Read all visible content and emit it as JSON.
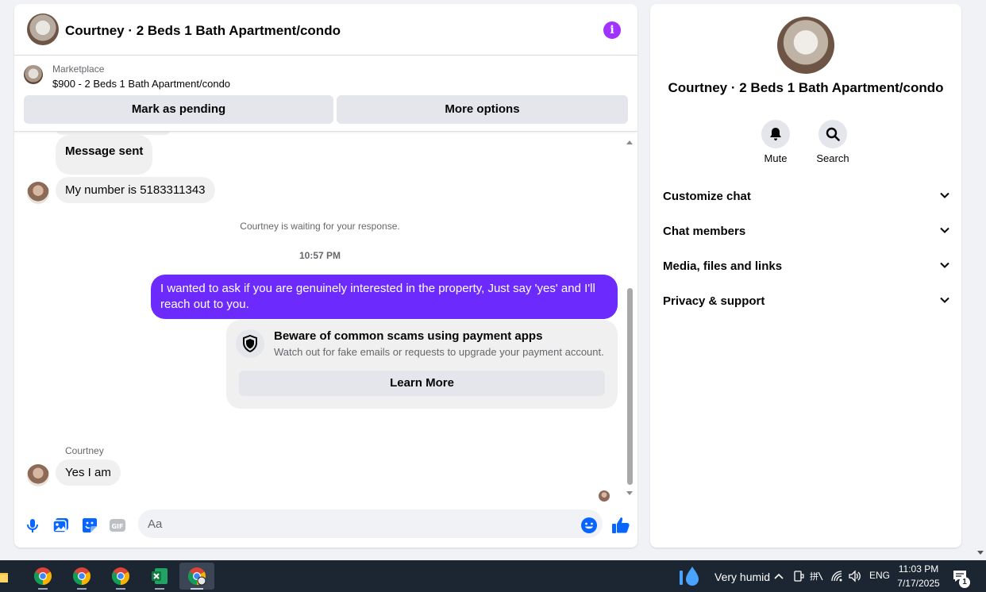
{
  "header": {
    "title": "Courtney · 2 Beds 1 Bath Apartment/condo"
  },
  "marketplace": {
    "label": "Marketplace",
    "item": "$900 - 2 Beds 1 Bath Apartment/condo",
    "pending_button": "Mark as pending",
    "more_button": "More options"
  },
  "messages": {
    "sent_status": "Message sent",
    "incoming_1": "My number is 5183311343",
    "system_notice": "Courtney is waiting for your response.",
    "timestamp": "10:57 PM",
    "outgoing_1": "I wanted to ask if you are genuinely interested in the property, Just say 'yes' and I'll reach out to you.",
    "scam_title": "Beware of common scams using payment apps",
    "scam_subtitle": "Watch out for fake emails or requests to upgrade your payment account.",
    "learn_more": "Learn More",
    "sender_name": "Courtney",
    "incoming_2": "Yes I am"
  },
  "composer": {
    "placeholder": "Aa"
  },
  "details": {
    "title": "Courtney · 2 Beds 1 Bath Apartment/condo",
    "mute_label": "Mute",
    "search_label": "Search",
    "sections": [
      {
        "label": "Customize chat"
      },
      {
        "label": "Chat members"
      },
      {
        "label": "Media, files and links"
      },
      {
        "label": "Privacy & support"
      }
    ]
  },
  "taskbar": {
    "weather": "Very humid",
    "language": "ENG",
    "time": "11:03 PM",
    "date": "7/17/2025",
    "notification_count": "1"
  },
  "colors": {
    "accent": "#6c2bfc",
    "messenger_blue": "#0866ff",
    "info_purple": "#a033ff"
  }
}
